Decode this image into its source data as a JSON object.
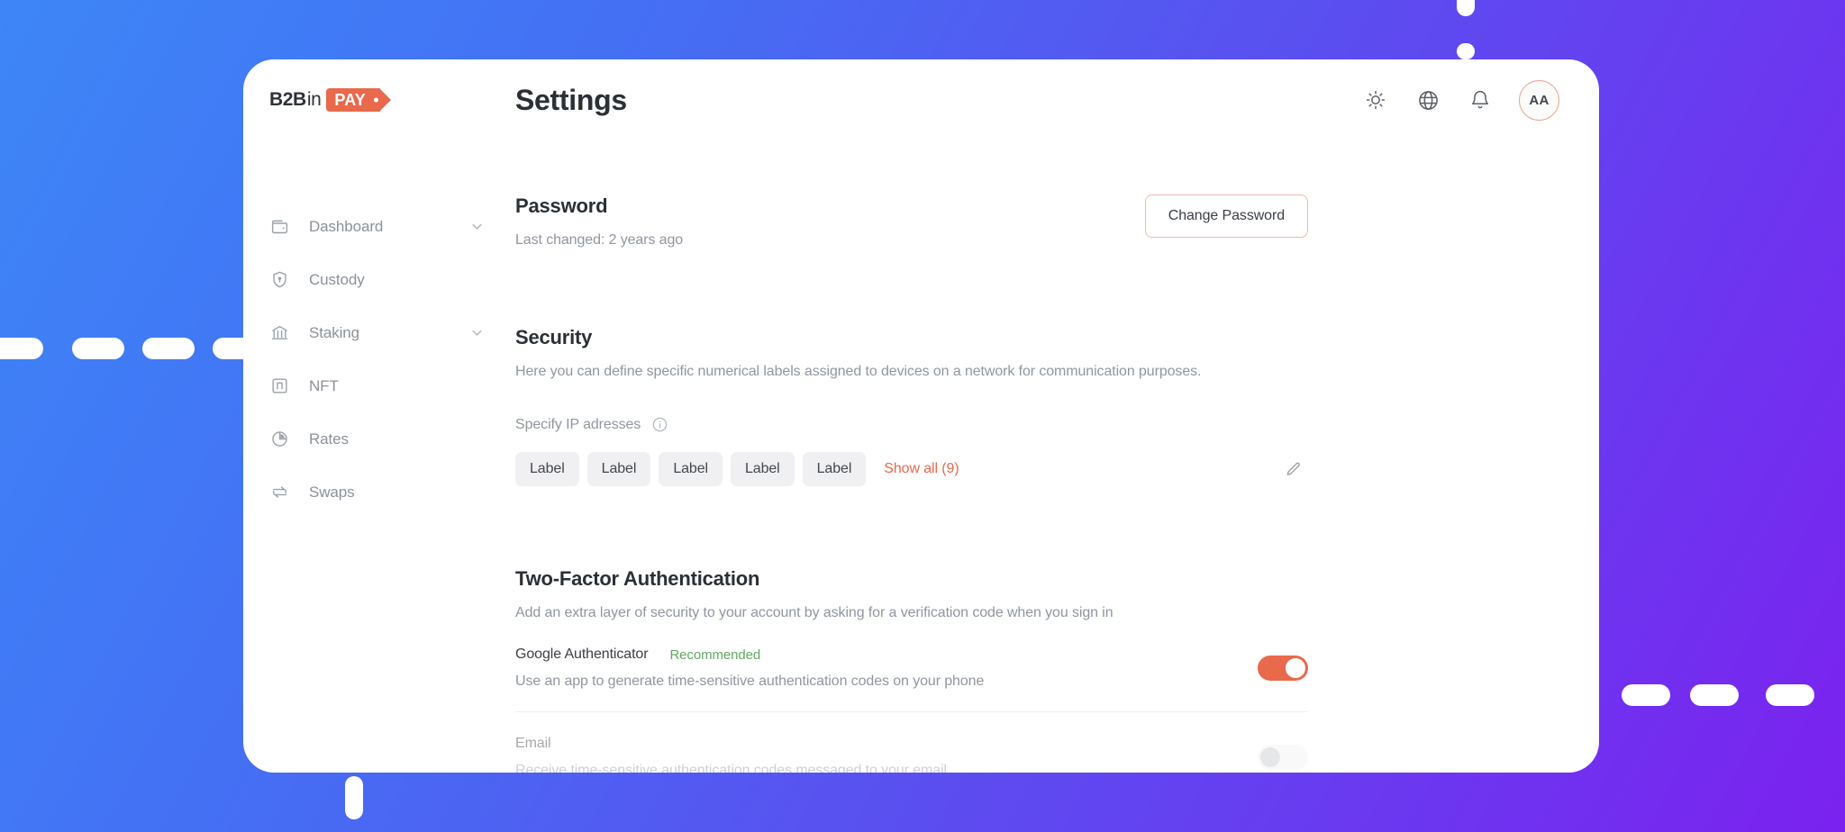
{
  "brand": {
    "name_main": "B2B",
    "name_suffix": "in",
    "tag": "PAY"
  },
  "header": {
    "title": "Settings",
    "icons": [
      {
        "name": "theme-toggle-icon",
        "label": "sun-icon"
      },
      {
        "name": "language-icon",
        "label": "globe-icon"
      },
      {
        "name": "notifications-icon",
        "label": "bell-icon"
      }
    ],
    "avatar_initials": "AA"
  },
  "sidebar": {
    "items": [
      {
        "label": "Dashboard",
        "icon": "wallet-icon",
        "expandable": true
      },
      {
        "label": "Custody",
        "icon": "shield-icon",
        "expandable": false
      },
      {
        "label": "Staking",
        "icon": "bank-icon",
        "expandable": true
      },
      {
        "label": "NFT",
        "icon": "nft-icon",
        "expandable": false
      },
      {
        "label": "Rates",
        "icon": "pie-chart-icon",
        "expandable": false
      },
      {
        "label": "Swaps",
        "icon": "swap-arrows-icon",
        "expandable": false
      }
    ]
  },
  "password_section": {
    "title": "Password",
    "last_changed": "Last changed: 2 years ago",
    "change_button": "Change Password"
  },
  "security_section": {
    "title": "Security",
    "description": "Here you can define specific numerical labels assigned to devices on a network for communication purposes.",
    "field_label": "Specify IP adresses",
    "chips": [
      "Label",
      "Label",
      "Label",
      "Label",
      "Label"
    ],
    "show_all": "Show all (9)",
    "edit_icon": "pencil-icon"
  },
  "two_factor_section": {
    "title": "Two-Factor Authentication",
    "description": "Add an extra layer of security to your account by asking for a verification code when you sign in",
    "methods": [
      {
        "name": "Google Authenticator",
        "badge": "Recommended",
        "description": "Use an app to generate time-sensitive authentication codes on your phone",
        "enabled": true,
        "disabled_row": false
      },
      {
        "name": "Email",
        "badge": "",
        "description": "Receive time-sensitive authentication codes messaged to your email",
        "enabled": false,
        "disabled_row": true
      }
    ]
  },
  "colors": {
    "accent": "#e8694b",
    "recommended": "#5fa95f",
    "bg_gradient_start": "#3d86f7",
    "bg_gradient_end": "#7b22ef",
    "card_bg": "#ffffff"
  }
}
